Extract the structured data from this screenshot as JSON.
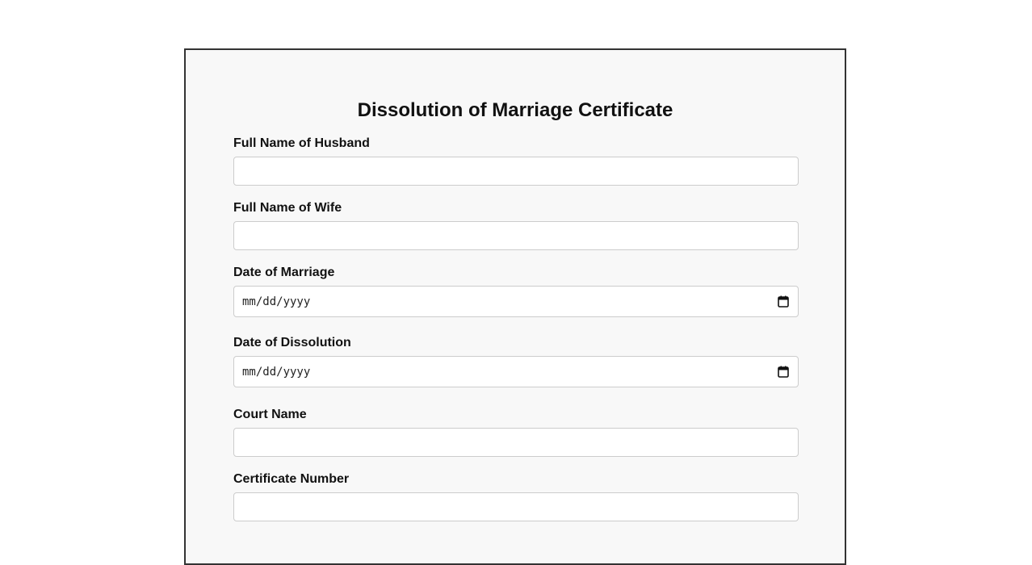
{
  "form": {
    "title": "Dissolution of Marriage Certificate",
    "husband": {
      "label": "Full Name of Husband",
      "value": ""
    },
    "wife": {
      "label": "Full Name of Wife",
      "value": ""
    },
    "marriage_date": {
      "label": "Date of Marriage",
      "placeholder": "mm/dd/yyyy",
      "icon": "calendar-icon"
    },
    "dissolution_date": {
      "label": "Date of Dissolution",
      "placeholder": "mm/dd/yyyy",
      "icon": "calendar-icon"
    },
    "court": {
      "label": "Court Name",
      "value": ""
    },
    "certificate_number": {
      "label": "Certificate Number",
      "value": ""
    }
  },
  "colors": {
    "page_background": "#ffffff",
    "panel_background": "#f8f8f8",
    "panel_border": "#333333",
    "input_border": "#cccccc"
  }
}
